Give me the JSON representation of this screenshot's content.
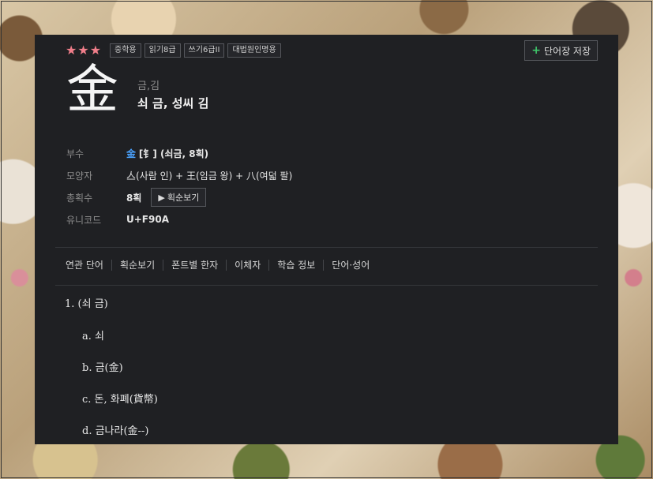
{
  "badges": [
    "중학용",
    "읽기8급",
    "쓰기6급II",
    "대법원인명용"
  ],
  "stars": "★★★",
  "save_button": {
    "icon": "+",
    "label": "단어장 저장"
  },
  "character": "金",
  "readings": "금,김",
  "meanings": "쇠 금, 성씨 김",
  "info": {
    "radical": {
      "label": "부수",
      "char": "金",
      "rest": "[钅] (쇠금, 8획)"
    },
    "shape": {
      "label": "모양자",
      "value": "亼(사람 인) + 王(임금 왕) + 八(여덟 팔)"
    },
    "strokes": {
      "label": "총획수",
      "value": "8획",
      "button_label": "획순보기"
    },
    "unicode": {
      "label": "유니코드",
      "value": "U+F90A"
    }
  },
  "tabs": [
    "연관 단어",
    "획순보기",
    "폰트별 한자",
    "이체자",
    "학습 정보",
    "단어·성어"
  ],
  "definitions": {
    "main": "1.  (쇠 금)",
    "items": [
      "a.  쇠",
      "b.  금(金)",
      "c.  돈, 화폐(貨幣)",
      "d.  금나라(金--)"
    ]
  }
}
